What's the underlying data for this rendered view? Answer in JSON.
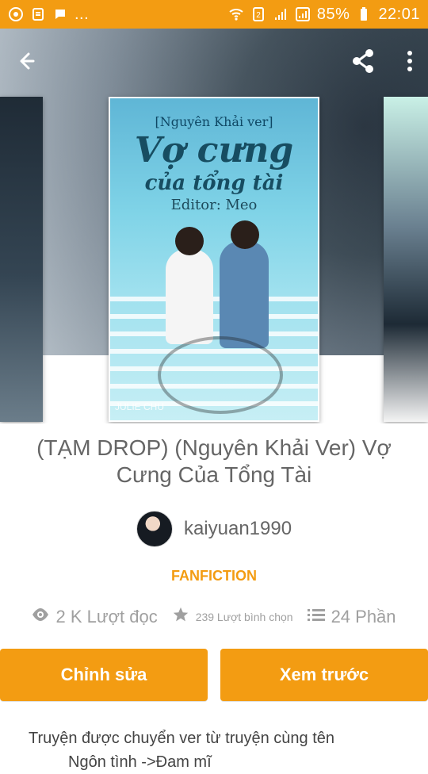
{
  "status_bar": {
    "left_icons": [
      "orange-circle-icon",
      "receipt-icon",
      "message-icon",
      "more-icon"
    ],
    "right": {
      "battery": "85%",
      "time": "22:01"
    }
  },
  "app_bar": {
    "back_icon": "arrow-left-icon",
    "share_icon": "share-icon",
    "menu_icon": "more-vert-icon"
  },
  "cover": {
    "tagline": "[Nguyên Khải ver]",
    "title_line1": "Vợ cưng",
    "title_line2": "của tổng tài",
    "editor": "Editor: Meo",
    "stamp": "JULIE CHU"
  },
  "story": {
    "title": "(TẠM DROP) (Nguyên Khải Ver) Vợ Cưng Của Tổng Tài",
    "author": "kaiyuan1990",
    "category": "FANFICTION",
    "stats": {
      "reads": "2 K Lượt đọc",
      "votes": "239 Lượt bình chọn",
      "parts": "24 Phần"
    }
  },
  "actions": {
    "edit": "Chỉnh sửa",
    "preview": "Xem trước"
  },
  "description": {
    "line1": "Truyện được chuyển ver từ truyện cùng tên",
    "line2": "Ngôn tình ->Đam mĩ"
  }
}
